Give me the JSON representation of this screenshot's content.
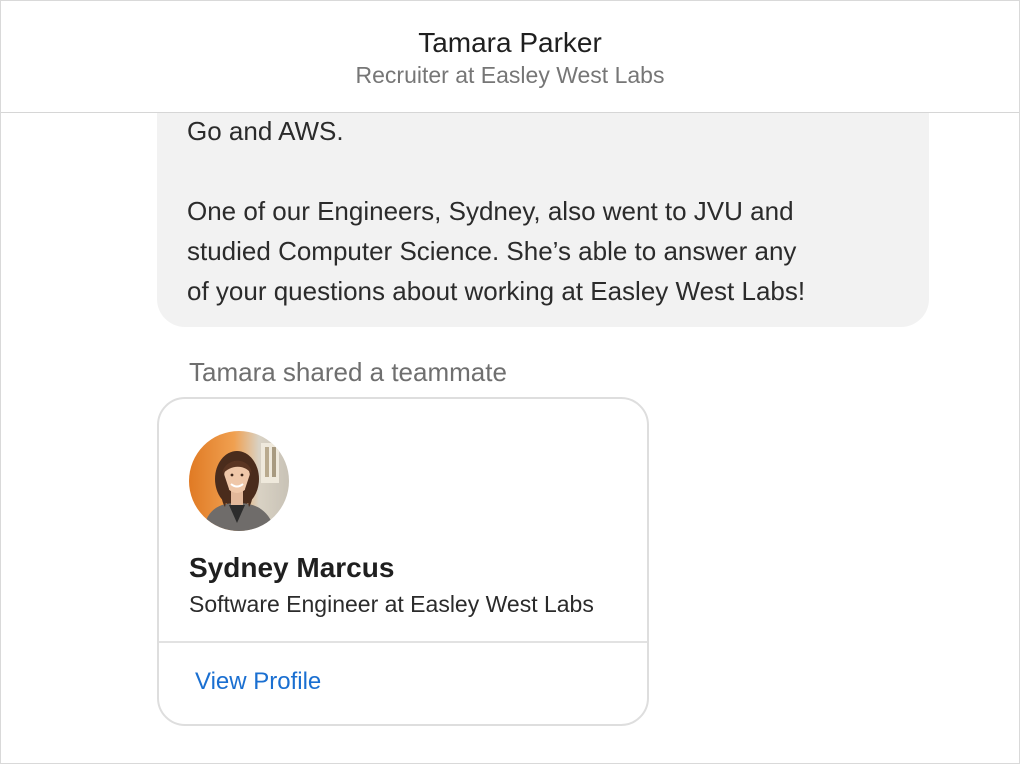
{
  "header": {
    "name": "Tamara Parker",
    "subtitle": "Recruiter at Easley West Labs"
  },
  "message": {
    "line_partial": "Go and AWS.",
    "paragraph_lines": [
      "One of our Engineers, Sydney, also went to JVU and",
      "studied Computer Science. She’s able to answer any",
      "of your questions about working at Easley West Labs!"
    ]
  },
  "shared": {
    "label": "Tamara shared a teammate",
    "card": {
      "avatar_icon": "profile-photo",
      "name": "Sydney Marcus",
      "role": "Software Engineer at Easley West Labs",
      "link_label": "View Profile"
    }
  },
  "colors": {
    "bubble": "#f2f2f2",
    "link": "#1a6fd1",
    "muted": "#767676"
  }
}
